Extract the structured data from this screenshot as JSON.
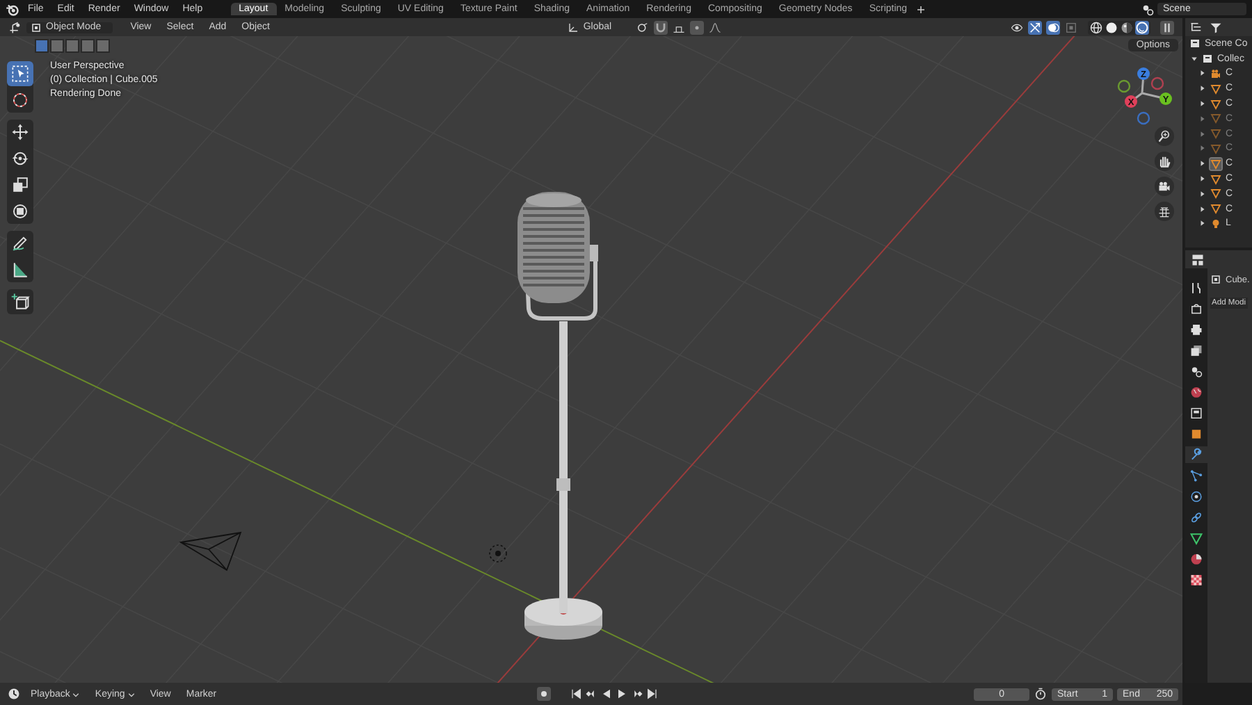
{
  "topbar": {
    "menus": [
      "File",
      "Edit",
      "Render",
      "Window",
      "Help"
    ],
    "workspaces": [
      {
        "label": "Layout",
        "selected": true
      },
      {
        "label": "Modeling",
        "selected": false
      },
      {
        "label": "Sculpting",
        "selected": false
      },
      {
        "label": "UV Editing",
        "selected": false
      },
      {
        "label": "Texture Paint",
        "selected": false
      },
      {
        "label": "Shading",
        "selected": false
      },
      {
        "label": "Animation",
        "selected": false
      },
      {
        "label": "Rendering",
        "selected": false
      },
      {
        "label": "Compositing",
        "selected": false
      },
      {
        "label": "Geometry Nodes",
        "selected": false
      },
      {
        "label": "Scripting",
        "selected": false
      }
    ],
    "scene": "Scene"
  },
  "viewport": {
    "mode": "Object Mode",
    "menus": [
      "View",
      "Select",
      "Add",
      "Object"
    ],
    "orientation": "Global",
    "options": "Options",
    "overlay": [
      "User Perspective",
      "(0) Collection | Cube.005",
      "Rendering Done"
    ],
    "select_modes": [
      {
        "selected": true
      },
      {
        "selected": false
      },
      {
        "selected": false
      },
      {
        "selected": false
      },
      {
        "selected": false
      }
    ],
    "tools": [
      {
        "kind": "select",
        "selected": true
      },
      {
        "kind": "cursor",
        "selected": false
      },
      {
        "kind": "move",
        "selected": false
      },
      {
        "kind": "rotate",
        "selected": false
      },
      {
        "kind": "scale",
        "selected": false
      },
      {
        "kind": "transform",
        "selected": false
      },
      {
        "kind": "annotate",
        "selected": false
      },
      {
        "kind": "measure",
        "selected": false
      },
      {
        "kind": "add-cube",
        "selected": false
      }
    ],
    "shading": [
      {
        "kind": "wireframe",
        "selected": false
      },
      {
        "kind": "solid",
        "selected": false
      },
      {
        "kind": "material",
        "selected": false
      },
      {
        "kind": "rendered",
        "selected": true
      }
    ],
    "gizmo_axes": [
      "X",
      "Y",
      "Z"
    ]
  },
  "outliner": {
    "title": "Scene Co",
    "collection": "Collec",
    "items": [
      {
        "kind": "camera",
        "label": "C",
        "disabled": false,
        "selected": false
      },
      {
        "kind": "mesh",
        "label": "C",
        "disabled": false,
        "selected": false
      },
      {
        "kind": "mesh",
        "label": "C",
        "disabled": false,
        "selected": false
      },
      {
        "kind": "mesh",
        "label": "C",
        "disabled": true,
        "selected": false
      },
      {
        "kind": "mesh",
        "label": "C",
        "disabled": true,
        "selected": false
      },
      {
        "kind": "mesh",
        "label": "C",
        "disabled": true,
        "selected": false
      },
      {
        "kind": "mesh",
        "label": "C",
        "disabled": false,
        "selected": true
      },
      {
        "kind": "mesh",
        "label": "C",
        "disabled": false,
        "selected": false
      },
      {
        "kind": "mesh",
        "label": "C",
        "disabled": false,
        "selected": false
      },
      {
        "kind": "mesh",
        "label": "C",
        "disabled": false,
        "selected": false
      },
      {
        "kind": "light",
        "label": "L",
        "disabled": false,
        "selected": false
      }
    ]
  },
  "properties": {
    "tabs": [
      {
        "kind": "tool",
        "selected": false
      },
      {
        "kind": "render",
        "selected": false
      },
      {
        "kind": "output",
        "selected": false
      },
      {
        "kind": "view-layer",
        "selected": false
      },
      {
        "kind": "scene",
        "selected": false
      },
      {
        "kind": "world",
        "selected": false
      },
      {
        "kind": "collection",
        "selected": false
      },
      {
        "kind": "object",
        "selected": false
      },
      {
        "kind": "modifier",
        "selected": true
      },
      {
        "kind": "particles",
        "selected": false
      },
      {
        "kind": "physics",
        "selected": false
      },
      {
        "kind": "constraints",
        "selected": false
      },
      {
        "kind": "data",
        "selected": false
      },
      {
        "kind": "material",
        "selected": false
      },
      {
        "kind": "texture",
        "selected": false
      }
    ],
    "object": "Cube.",
    "button": "Add Modi"
  },
  "timeline": {
    "menus": [
      {
        "label": "Playback",
        "dropdown": true
      },
      {
        "label": "Keying",
        "dropdown": true
      },
      {
        "label": "View",
        "dropdown": false
      },
      {
        "label": "Marker",
        "dropdown": false
      }
    ],
    "frame": "0",
    "start_label": "Start",
    "start": "1",
    "end_label": "End",
    "end": "250"
  }
}
